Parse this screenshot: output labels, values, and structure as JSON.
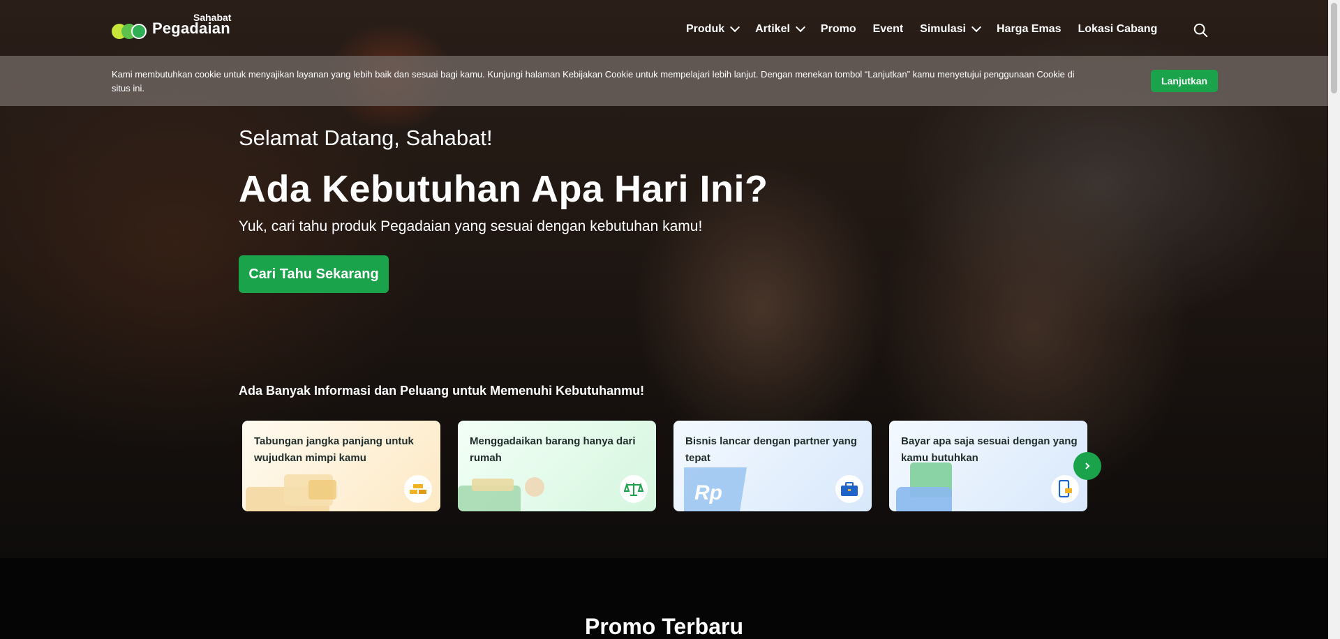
{
  "logo": {
    "small": "Sahabat",
    "big": "Pegadaian"
  },
  "nav": {
    "items": [
      {
        "label": "Produk",
        "dropdown": true
      },
      {
        "label": "Artikel",
        "dropdown": true
      },
      {
        "label": "Promo",
        "dropdown": false
      },
      {
        "label": "Event",
        "dropdown": false
      },
      {
        "label": "Simulasi",
        "dropdown": true
      },
      {
        "label": "Harga Emas",
        "dropdown": false
      },
      {
        "label": "Lokasi Cabang",
        "dropdown": false
      }
    ],
    "search_icon": "search-icon"
  },
  "cookie": {
    "text": "Kami membutuhkan cookie untuk menyajikan layanan yang lebih baik dan sesuai bagi kamu. Kunjungi halaman Kebijakan Cookie untuk mempelajari lebih lanjut. Dengan menekan tombol “Lanjutkan” kamu menyetujui penggunaan Cookie di situs ini.",
    "button": "Lanjutkan"
  },
  "hero": {
    "greeting": "Selamat Datang, Sahabat!",
    "headline": "Ada Kebutuhan Apa Hari Ini?",
    "subtitle": "Yuk, cari tahu produk Pegadaian yang sesuai dengan kebutuhan kamu!",
    "cta": "Cari Tahu Sekarang"
  },
  "info": {
    "title": "Ada Banyak Informasi dan Peluang untuk Memenuhi Kebutuhanmu!",
    "cards": [
      {
        "text": "Tabungan jangka panjang untuk wujudkan mimpi kamu",
        "icon": "gold-bars-icon"
      },
      {
        "text": "Menggadaikan barang hanya dari rumah",
        "icon": "scale-icon"
      },
      {
        "text": "Bisnis lancar dengan partner yang tepat",
        "icon": "briefcase-icon"
      },
      {
        "text": "Bayar apa saja sesuai dengan yang kamu butuhkan",
        "icon": "phone-payment-icon"
      }
    ],
    "next_icon": "chevron-right-icon"
  },
  "promo": {
    "title": "Promo Terbaru"
  },
  "colors": {
    "brand_green": "#1aa34a",
    "cookie_bg": "#6e645f"
  }
}
